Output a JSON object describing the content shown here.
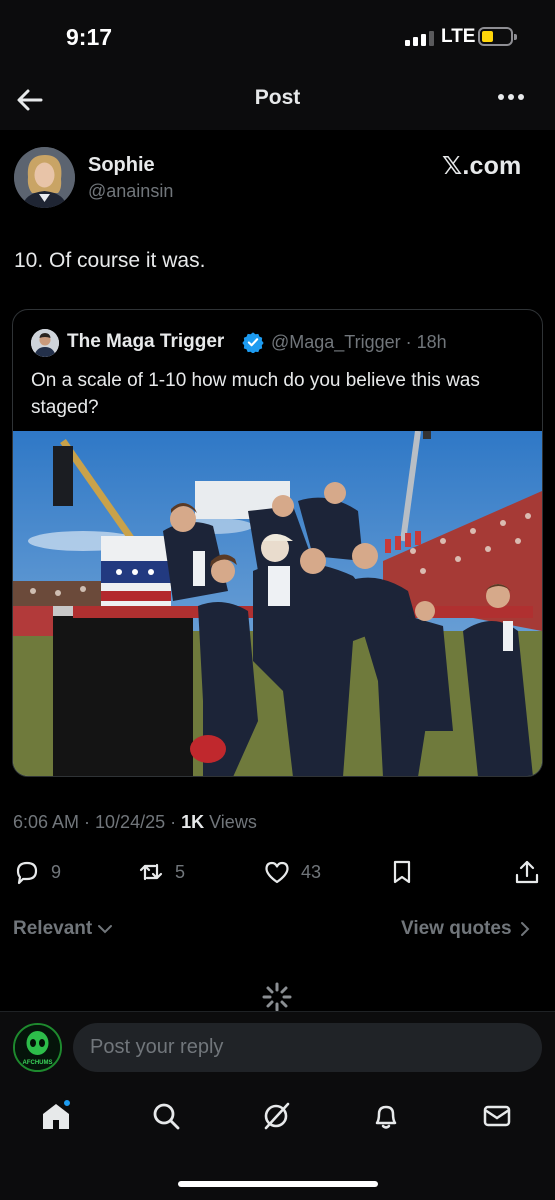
{
  "status_bar": {
    "time": "9:17",
    "network": "LTE"
  },
  "header": {
    "title": "Post"
  },
  "post": {
    "author_name": "Sophie",
    "author_handle": "@anainsin",
    "brand": "𝕏.com",
    "text": "10. Of course it was.",
    "meta_time": "6:06 AM · 10/24/25 · ",
    "meta_views_count": "1K",
    "meta_views_label": " Views"
  },
  "quote": {
    "name": "The Maga Trigger",
    "handle_time": "@Maga_Trigger · 18h",
    "text": "On a scale of 1-10 how much do you believe  this was staged?"
  },
  "actions": {
    "replies": "9",
    "reposts": "5",
    "likes": "43"
  },
  "replies_filter": {
    "sort_label": "Relevant",
    "view_quotes_label": "View quotes"
  },
  "reply_bar": {
    "placeholder": "Post your reply",
    "avatar_text": "AFCHUMS"
  },
  "colors": {
    "background": "#000000",
    "text": "#e7e9ea",
    "muted": "#71767b",
    "verified": "#1d9bf0",
    "battery": "#ffd60a"
  },
  "icons": [
    "back-arrow-icon",
    "more-icon",
    "verified-icon",
    "reply-icon",
    "repost-icon",
    "like-icon",
    "bookmark-icon",
    "share-icon",
    "chevron-down-icon",
    "chevron-right-icon",
    "loading-spinner-icon",
    "home-icon",
    "search-icon",
    "grok-icon",
    "bell-icon",
    "mail-icon"
  ]
}
